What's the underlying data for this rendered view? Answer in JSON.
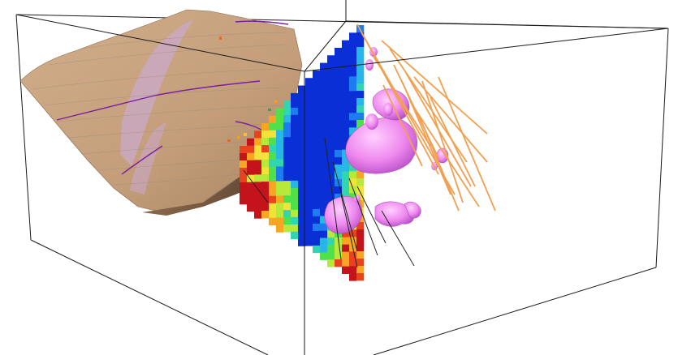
{
  "viewport": {
    "background": "#ffffff"
  },
  "scene": {
    "bounding_box_color": "#1a1a1a",
    "terrain_color": "#c8a27f",
    "terrain_shadow_color": "#7a5a3e",
    "geology_band_color": "#c9a9c9",
    "contour_color": "#9a8a7a",
    "fault_trace_color": "#7a1fa2",
    "block_model_palette": [
      "#0a2fd6",
      "#1c7cf0",
      "#27b6e6",
      "#2fd6b0",
      "#4fe04a",
      "#b8e83a",
      "#f2e23a",
      "#f6a623",
      "#e8431c",
      "#c2141a"
    ],
    "isosurface_color": "#ee88ee",
    "isosurface_edge_color": "#b050c0",
    "drillhole_color": "#f0a050",
    "drillhole_dark_color": "#222222"
  }
}
